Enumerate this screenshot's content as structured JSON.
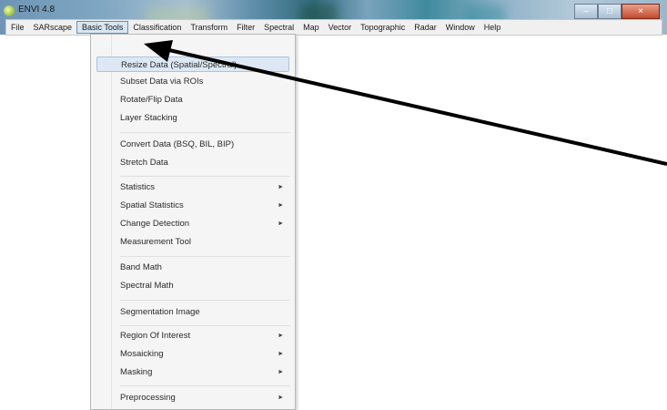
{
  "window": {
    "title": "ENVI 4.8",
    "controls": [
      "–",
      "□",
      "×"
    ]
  },
  "menubar": {
    "items": [
      "File",
      "SARscape",
      "Basic Tools",
      "Classification",
      "Transform",
      "Filter",
      "Spectral",
      "Map",
      "Vector",
      "Topographic",
      "Radar",
      "Window",
      "Help"
    ],
    "active": "Basic Tools"
  },
  "dropdown": {
    "items": [
      {
        "label": "Resize Data (Spatial/Spectral)",
        "submenu": false,
        "highlighted": true
      },
      {
        "label": "Subset Data via ROIs",
        "submenu": false
      },
      {
        "label": "Rotate/Flip Data",
        "submenu": false
      },
      {
        "label": "Layer Stacking",
        "submenu": false
      },
      {
        "label": "Convert Data (BSQ, BIL, BIP)",
        "submenu": false
      },
      {
        "label": "Stretch Data",
        "submenu": false
      },
      {
        "label": "Statistics",
        "submenu": true
      },
      {
        "label": "Spatial Statistics",
        "submenu": true
      },
      {
        "label": "Change Detection",
        "submenu": true
      },
      {
        "label": "Measurement Tool",
        "submenu": false
      },
      {
        "label": "Band Math",
        "submenu": false
      },
      {
        "label": "Spectral Math",
        "submenu": false
      },
      {
        "label": "Segmentation Image",
        "submenu": false
      },
      {
        "label": "Region Of Interest",
        "submenu": true
      },
      {
        "label": "Mosaicking",
        "submenu": true
      },
      {
        "label": "Masking",
        "submenu": true
      },
      {
        "label": "Preprocessing",
        "submenu": true
      }
    ],
    "submenu_glyph": "►"
  },
  "colors": {
    "highlight": "#dde8f4",
    "arrow": "#000000"
  }
}
